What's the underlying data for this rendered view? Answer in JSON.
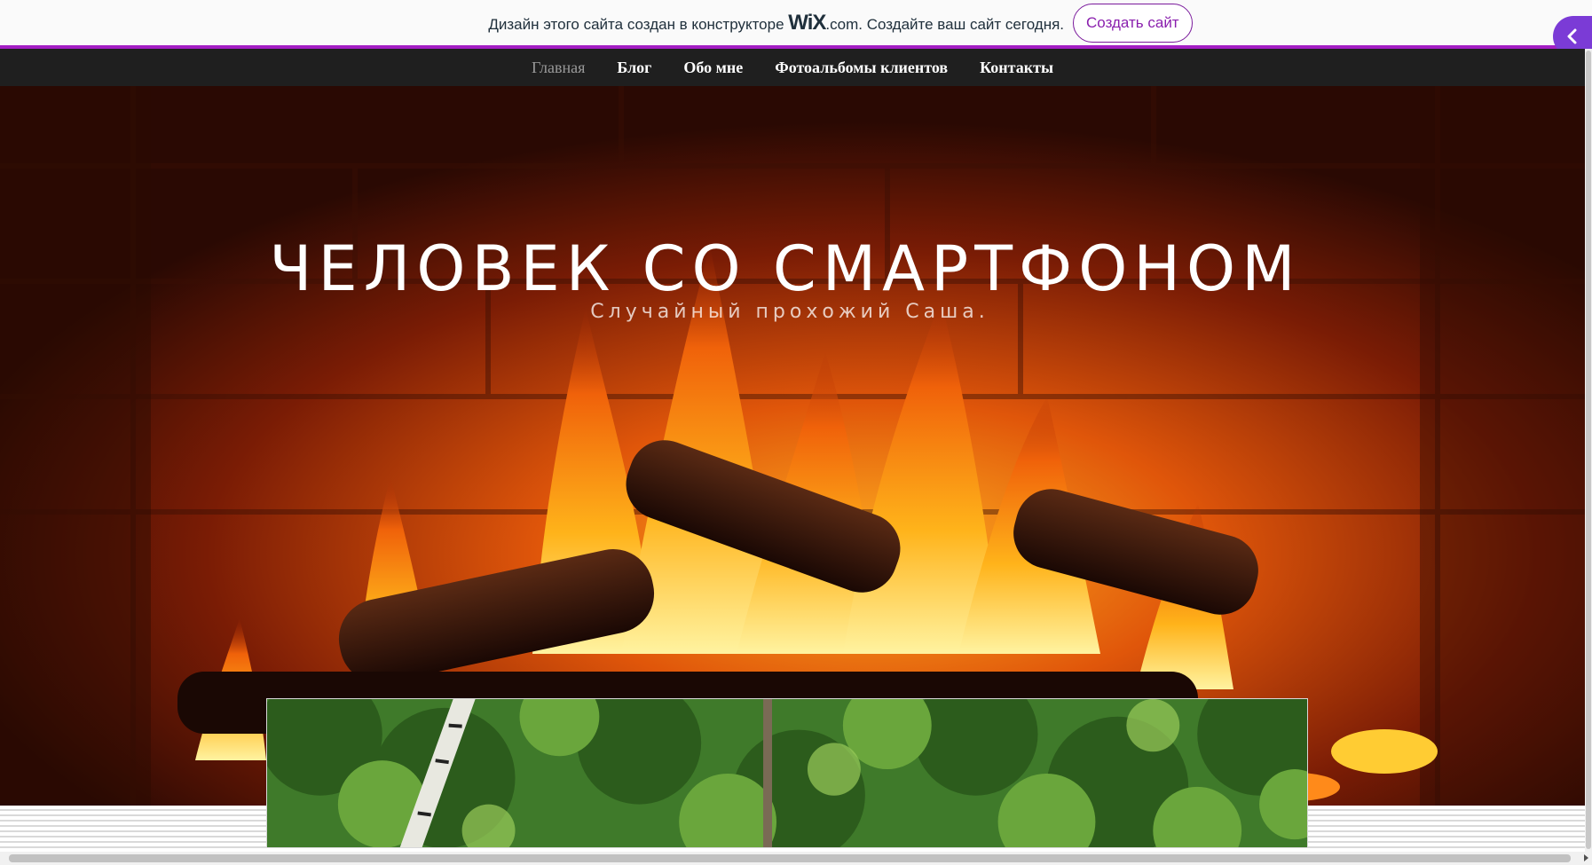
{
  "wix_banner": {
    "text": "Дизайн этого сайта создан в конструкторе",
    "logo": "WiX",
    "logo_domain": ".com.",
    "tagline": "Создайте ваш сайт сегодня.",
    "cta_label": "Создать сайт",
    "accent_color": "#a31ec4"
  },
  "side_tab": {
    "icon": "chevron-left-icon"
  },
  "nav": {
    "items": [
      {
        "label": "Главная",
        "active": true
      },
      {
        "label": "Блог"
      },
      {
        "label": "Обо мне"
      },
      {
        "label": "Фотоальбомы клиентов"
      },
      {
        "label": "Контакты"
      }
    ]
  },
  "hero": {
    "title": "ЧЕЛОВЕК СО СМАРТФОНОМ",
    "subtitle": "Случайный прохожий Саша."
  }
}
